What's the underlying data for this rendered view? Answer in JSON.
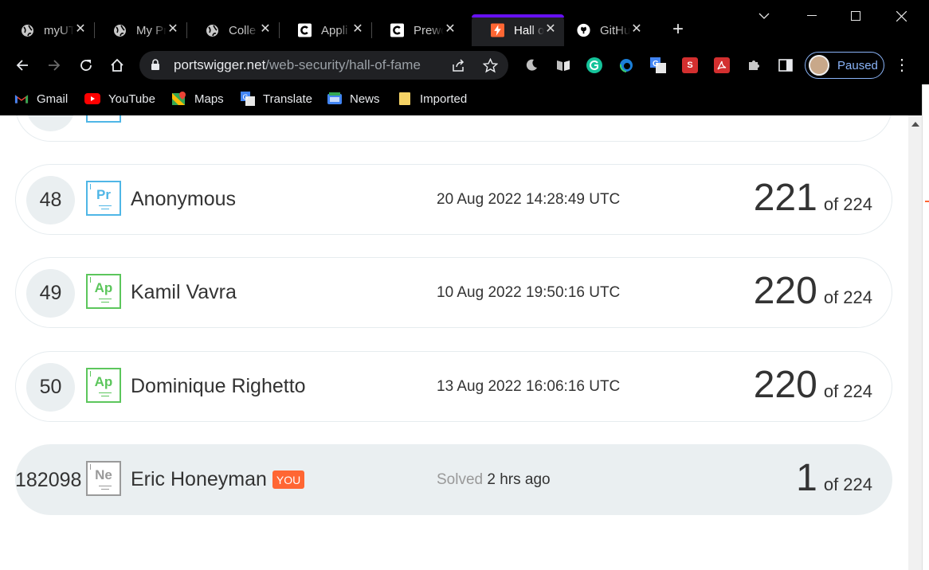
{
  "browser": {
    "tabs": [
      {
        "title": "myUT",
        "icon": "globe-icon"
      },
      {
        "title": "My Pr",
        "icon": "globe-icon"
      },
      {
        "title": "Colle",
        "icon": "globe-icon"
      },
      {
        "title": "Appli",
        "icon": "g-box-icon"
      },
      {
        "title": "Prewo",
        "icon": "g-box-icon"
      },
      {
        "title": "Hall o",
        "icon": "burp-icon",
        "active": true
      },
      {
        "title": "GitHu",
        "icon": "github-icon"
      }
    ],
    "url_host": "portswigger.net",
    "url_path": "/web-security/hall-of-fame",
    "profile_label": "Paused",
    "bookmarks": [
      {
        "label": "Gmail",
        "icon": "gmail-icon"
      },
      {
        "label": "YouTube",
        "icon": "youtube-icon"
      },
      {
        "label": "Maps",
        "icon": "maps-icon"
      },
      {
        "label": "Translate",
        "icon": "translate-icon"
      },
      {
        "label": "News",
        "icon": "news-icon"
      },
      {
        "label": "Imported",
        "icon": "folder-icon"
      }
    ]
  },
  "leaderboard": {
    "rows": [
      {
        "rank": "48",
        "badge": "Pr",
        "badge_color": "#4fb6e6",
        "name": "Anonymous",
        "date": "20 Aug 2022 14:28:49 UTC",
        "score": "221",
        "of": "of 224"
      },
      {
        "rank": "49",
        "badge": "Ap",
        "badge_color": "#5cc65c",
        "name": "Kamil Vavra",
        "date": "10 Aug 2022 19:50:16 UTC",
        "score": "220",
        "of": "of 224"
      },
      {
        "rank": "50",
        "badge": "Ap",
        "badge_color": "#5cc65c",
        "name": "Dominique Righetto",
        "date": "13 Aug 2022 16:06:16 UTC",
        "score": "220",
        "of": "of 224"
      }
    ],
    "you": {
      "rank": "182098",
      "badge": "Ne",
      "badge_color": "#9a9a9a",
      "name": "Eric Honeyman",
      "you_label": "YOU",
      "solved_label": "Solved",
      "solved_time": "2 hrs ago",
      "score": "1",
      "of": "of 224"
    }
  }
}
